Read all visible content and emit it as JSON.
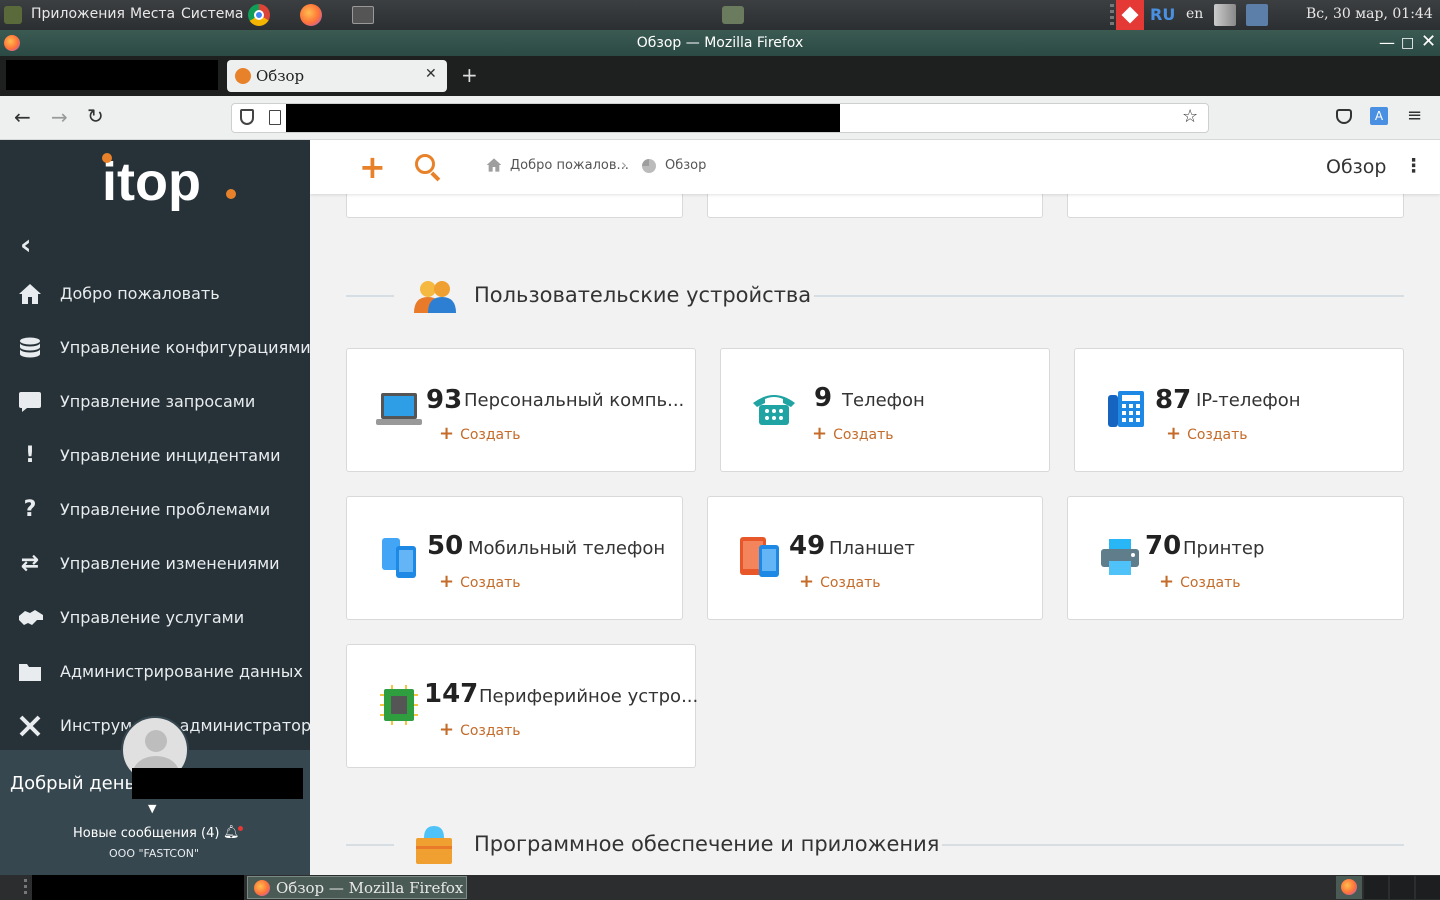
{
  "os_panel": {
    "menus": [
      "Приложения",
      "Места",
      "Система"
    ],
    "keyboard_layout": "RU",
    "lang": "en",
    "clock": "Вс, 30 мар, 01:44"
  },
  "window": {
    "title": "Обзор — Mozilla Firefox"
  },
  "browser": {
    "active_tab": "Обзор",
    "new_tab_symbol": "+"
  },
  "sidebar": {
    "items": [
      {
        "label": "Добро пожаловать",
        "icon": "home-icon"
      },
      {
        "label": "Управление конфигурациями",
        "icon": "database-icon"
      },
      {
        "label": "Управление запросами",
        "icon": "chat-bubble-icon"
      },
      {
        "label": "Управление инцидентами",
        "icon": "exclamation-icon"
      },
      {
        "label": "Управление проблемами",
        "icon": "question-icon"
      },
      {
        "label": "Управление изменениями",
        "icon": "swap-arrows-icon"
      },
      {
        "label": "Управление услугами",
        "icon": "handshake-icon"
      },
      {
        "label": "Администрирование данных",
        "icon": "folder-icon"
      },
      {
        "label": "Инструменты администратора",
        "icon": "tools-icon"
      }
    ],
    "greeting": "Добрый день,",
    "messages": "Новые сообщения (4)",
    "org": "ООО \"FASTCON\""
  },
  "topbar": {
    "breadcrumb_home": "Добро пожалов...",
    "breadcrumb_current": "Обзор",
    "page_title": "Обзор",
    "kebab": "⋮"
  },
  "sections": {
    "user_devices": "Пользовательские устройства",
    "software": "Программное обеспечение и приложения"
  },
  "cards": [
    {
      "count": "93",
      "name": "Персональный компь...",
      "create": "Создать"
    },
    {
      "count": "9",
      "name": "Телефон",
      "create": "Создать"
    },
    {
      "count": "87",
      "name": "IP-телефон",
      "create": "Создать"
    },
    {
      "count": "50",
      "name": "Мобильный телефон",
      "create": "Создать"
    },
    {
      "count": "49",
      "name": "Планшет",
      "create": "Создать"
    },
    {
      "count": "70",
      "name": "Принтер",
      "create": "Создать"
    },
    {
      "count": "147",
      "name": "Периферийное устро...",
      "create": "Создать"
    }
  ],
  "taskbar": {
    "window_button": "Обзор — Mozilla Firefox"
  },
  "colors": {
    "accent": "#e8822a",
    "sidebar_bg": "#263238",
    "create_link": "#c46b2a"
  }
}
